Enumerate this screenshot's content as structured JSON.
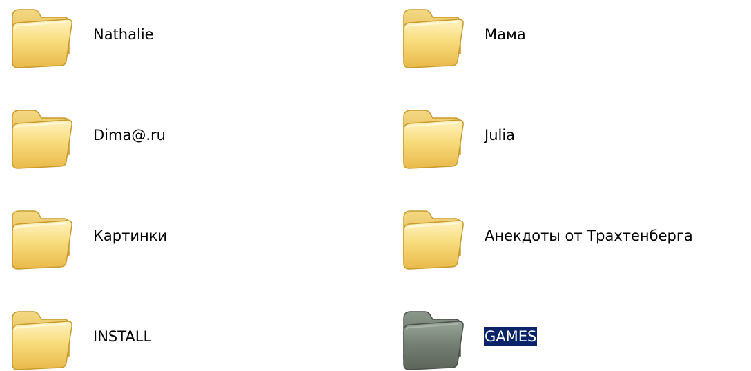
{
  "colors": {
    "folder_fill": "#f7d86f",
    "folder_selected_fill": "#6b7467",
    "selection_bg": "#0a246a",
    "selection_text": "#ffffff"
  },
  "folders": [
    {
      "label": "Nathalie",
      "icon": "folder-icon",
      "selected": false
    },
    {
      "label": "Мама",
      "icon": "folder-icon",
      "selected": false
    },
    {
      "label": "Dima@.ru",
      "icon": "folder-icon",
      "selected": false
    },
    {
      "label": "Julia",
      "icon": "folder-icon",
      "selected": false
    },
    {
      "label": "Картинки",
      "icon": "folder-icon",
      "selected": false
    },
    {
      "label": "Анекдоты от Трахтенберга",
      "icon": "folder-icon",
      "selected": false
    },
    {
      "label": "INSTALL",
      "icon": "folder-icon",
      "selected": false
    },
    {
      "label": "GAMES",
      "icon": "folder-icon",
      "selected": true
    }
  ]
}
